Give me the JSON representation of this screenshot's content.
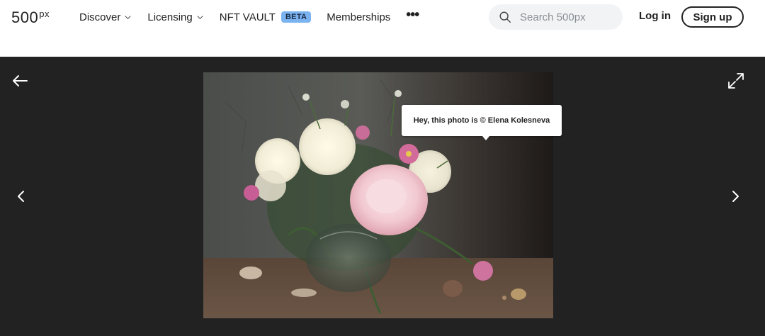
{
  "brand": {
    "logo_main": "500",
    "logo_sup": "px"
  },
  "nav": {
    "discover": "Discover",
    "licensing": "Licensing",
    "nft_vault": "NFT VAULT",
    "nft_badge": "BETA",
    "memberships": "Memberships",
    "more": "•••"
  },
  "search": {
    "placeholder": "Search 500px",
    "value": ""
  },
  "auth": {
    "login": "Log in",
    "signup": "Sign up"
  },
  "photo": {
    "tooltip": "Hey, this photo is © Elena Kolesneva",
    "background_color": "#222222"
  },
  "icons": {
    "back": "arrow-left-icon",
    "expand": "expand-icon",
    "prev": "chevron-left-icon",
    "next": "chevron-right-icon",
    "search": "search-icon",
    "dropdown": "chevron-down-icon"
  },
  "colors": {
    "beta_badge": "#7bb3f0",
    "viewer_bg": "#222222",
    "text": "#222222"
  }
}
